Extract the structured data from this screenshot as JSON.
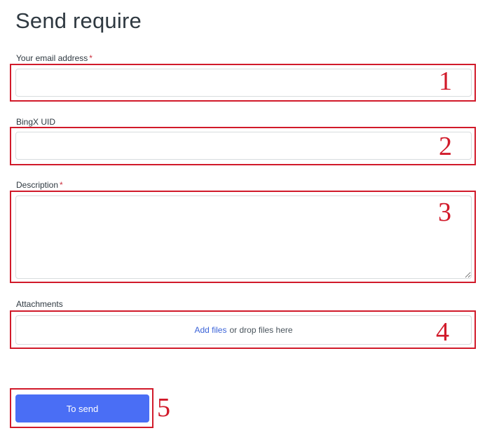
{
  "page": {
    "title": "Send require"
  },
  "form": {
    "email": {
      "label": "Your email address",
      "required_mark": "*",
      "value": ""
    },
    "uid": {
      "label": "BingX UID",
      "value": ""
    },
    "description": {
      "label": "Description",
      "required_mark": "*",
      "value": ""
    },
    "attachments": {
      "label": "Attachments",
      "add_link": "Add files",
      "drop_text": "or drop files here"
    },
    "submit": {
      "label": "To send"
    }
  },
  "annotations": {
    "markers": [
      "1",
      "2",
      "3",
      "4",
      "5"
    ],
    "highlight_color": "#d11a2a"
  },
  "colors": {
    "accent": "#4a6ef5",
    "link": "#3b63d8",
    "required": "#cc3340"
  }
}
